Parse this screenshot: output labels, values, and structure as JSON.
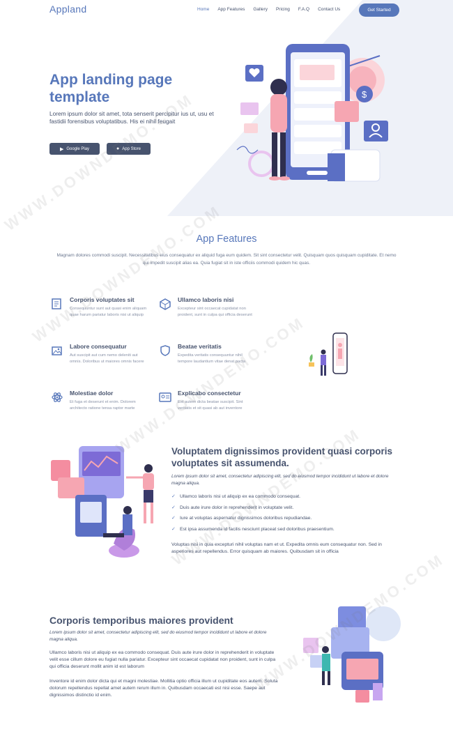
{
  "header": {
    "logo": "Appland",
    "nav": [
      "Home",
      "App Features",
      "Gallery",
      "Pricing",
      "F.A.Q",
      "Contact Us"
    ],
    "cta": "Get Started"
  },
  "hero": {
    "title": "App landing page template",
    "text": "Lorem ipsum dolor sit amet, tota senserit percipitur ius ut, usu et fastidii forensibus voluptatibus. His ei nihil feugait",
    "google_play": "Google Play",
    "app_store": "App Store"
  },
  "features": {
    "title": "App Features",
    "subtitle": "Magnam dolores commodi suscipit. Necessitatibus eius consequatur ex aliquid fuga eum quidem. Sit sint consectetur velit. Quisquam quos quisquam cupiditate. Et nemo qui impedit suscipit alias ea. Quia fugiat sit in iste officiis commodi quidem hic quas.",
    "items": [
      {
        "title": "Corporis voluptates sit",
        "desc": "Consequuntur sunt aut quasi enim aliquam quae harum pariatur laboris nisi ut aliquip",
        "icon": "receipt-icon"
      },
      {
        "title": "Ullamco laboris nisi",
        "desc": "Excepteur sint occaecat cupidatat non proident, sunt in culpa qui officia deserunt",
        "icon": "cube-icon"
      },
      {
        "title": "Labore consequatur",
        "desc": "Aut suscipit aut cum nemo deleniti aut omnis. Doloribus ut maiores omnis facere",
        "icon": "images-icon"
      },
      {
        "title": "Beatae veritatis",
        "desc": "Expedita veritatis consequuntur nihil tempore laudantium vitae denat pacta",
        "icon": "shield-icon"
      },
      {
        "title": "Molestiae dolor",
        "desc": "Et fuga et deserunt et enim. Dolorem architecto ratione tensa raptor marte",
        "icon": "atom-icon"
      },
      {
        "title": "Explicabo consectetur",
        "desc": "Est autem dicta beatae suscipit. Sint veritatis et sit quasi ab aut inventore",
        "icon": "id-card-icon"
      }
    ]
  },
  "detail1": {
    "title": "Voluptatem dignissimos provident quasi corporis voluptates sit assumenda.",
    "italic": "Lorem ipsum dolor sit amet, consectetur adipiscing elit, sed do eiusmod tempor incididunt ut labore et dolore magna aliqua.",
    "list": [
      "Ullamco laboris nisi ut aliquip ex ea commodo consequat.",
      "Duis aute irure dolor in reprehenderit in voluptate velit.",
      "Iure at voluptas aspernatur dignissimos doloribus repudiandae.",
      "Est ipsa assumenda id facilis nesciunt placeat sed doloribus praesentium."
    ],
    "para": "Voluptas nisi in quia excepturi nihil voluptas nam et ut. Expedita omnis eum consequatur non. Sed in asperiores aut repellendus. Error quisquam ab maiores. Quibusdam sit in officia"
  },
  "detail2": {
    "title": "Corporis temporibus maiores provident",
    "italic": "Lorem ipsum dolor sit amet, consectetur adipiscing elit, sed do eiusmod tempor incididunt ut labore et dolore magna aliqua.",
    "para1": "Ullamco laboris nisi ut aliquip ex ea commodo consequat. Duis aute irure dolor in reprehenderit in voluptate velit esse cillum dolore eu fugiat nulla pariatur. Excepteur sint occaecat cupidatat non proident, sunt in culpa qui officia deserunt mollit anim id est laborum",
    "para2": "Inventore id enim dolor dicta qui et magni molestiae. Mollitia optio officia illum ut cupiditate eos autem. Soluta dolorum repellendus repellat amet autem rerum illum in. Quibusdam occaecati est nisi esse. Saepe aut dignissimos distinctio id enim."
  },
  "watermark": "WWW.DOWNDEMO.COM",
  "colors": {
    "accent": "#5777ba",
    "text": "#47536e",
    "hero_bg": "#eef1f8",
    "pink": "#f6a6b2"
  }
}
